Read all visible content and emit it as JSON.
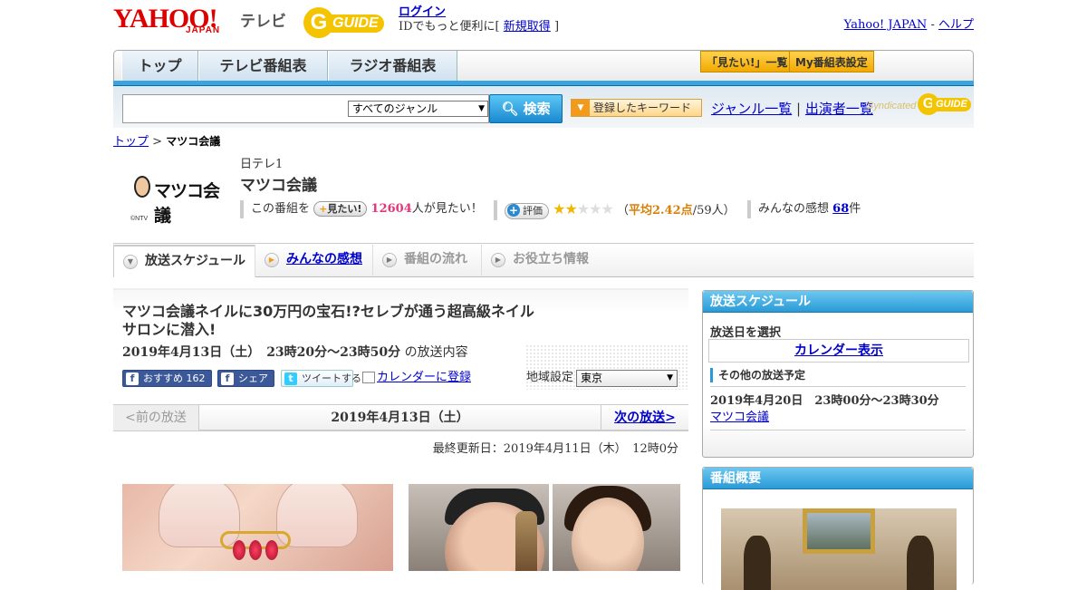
{
  "header": {
    "brand_yahoo": "YAHOO!",
    "brand_japan": "JAPAN",
    "brand_tv": "テレビ",
    "gguide_g": "G",
    "gguide_text": "GUIDE",
    "login": "ログイン",
    "login_note_prefix": "IDでもっと便利に[",
    "register": "新規取得",
    "login_note_suffix": "]",
    "yahoo_japan_link": "Yahoo! JAPAN",
    "separator": "-",
    "help_link": "ヘルプ"
  },
  "nav": {
    "tabs": [
      "トップ",
      "テレビ番組表",
      "ラジオ番組表"
    ],
    "mitai_list": "「見たい!」一覧",
    "my_schedule": "My番組表設定"
  },
  "search": {
    "genre_selected": "すべてのジャンル",
    "button": "検索",
    "keyword_button": "登録したキーワード",
    "genre_list": "ジャンル一覧",
    "divider": "|",
    "performer_list": "出演者一覧",
    "syndicated": "Syndicated",
    "gguide_g": "G",
    "gguide_text": "GUIDE"
  },
  "breadcrumb": {
    "top": "トップ",
    "sep": ">",
    "current": "マツコ会議"
  },
  "program": {
    "logo_text": "マツコ会議",
    "logo_copyright": "©NTV",
    "channel": "日テレ1",
    "title": "マツコ会議",
    "mitai_prefix": "この番組を",
    "mitai_button": "見たい!",
    "mitai_plus": "+",
    "mitai_count": "12604",
    "mitai_suffix": "人が見たい！",
    "hyoka_plus": "+",
    "hyoka_button": "評価",
    "rating_open": "（",
    "rating_avg": "平均2.42点",
    "rating_count": "/59人）",
    "comments_prefix": "みんなの感想",
    "comments_count": "68",
    "comments_suffix": "件",
    "stars_on": "★★",
    "stars_off": "★★★"
  },
  "subtabs": {
    "icon": "▶",
    "icon_active": "▼",
    "items": [
      "放送スケジュール",
      "みんなの感想",
      "番組の流れ",
      "お役立ち情報"
    ]
  },
  "episode": {
    "title": "マツコ会議ネイルに30万円の宝石!?セレブが通う超高級ネイルサロンに潜入!",
    "air_time": "2019年4月13日（土）　23時20分～23時50分",
    "air_suffix": "の放送内容",
    "fb_recommend": "おすすめ",
    "fb_count": "162",
    "fb_icon": "f",
    "fb_share": "シェア",
    "tw_icon": "t",
    "tweet": "ツイートする",
    "calendar_register": "カレンダーに登録",
    "region_label": "地域設定",
    "region_selected": "東京",
    "select_arrow": "▼"
  },
  "pager": {
    "prev": "<前の放送",
    "date": "2019年4月13日（土）",
    "next": "次の放送>"
  },
  "updated": "最終更新日：2019年4月11日（木）　12時0分",
  "sidebar": {
    "schedule_title": "放送スケジュール",
    "select_date": "放送日を選択",
    "calendar_button": "カレンダー表示",
    "other_head": "その他の放送予定",
    "other_time": "2019年4月20日　23時00分～23時30分",
    "other_link": "マツコ会議",
    "overview_title": "番組概要"
  },
  "colors": {
    "accent_blue": "#2a9ad6",
    "link": "#0000cc",
    "brand_red": "#dd0000",
    "gguide_yellow": "#f5c400",
    "mitai_pink": "#e0387a"
  }
}
